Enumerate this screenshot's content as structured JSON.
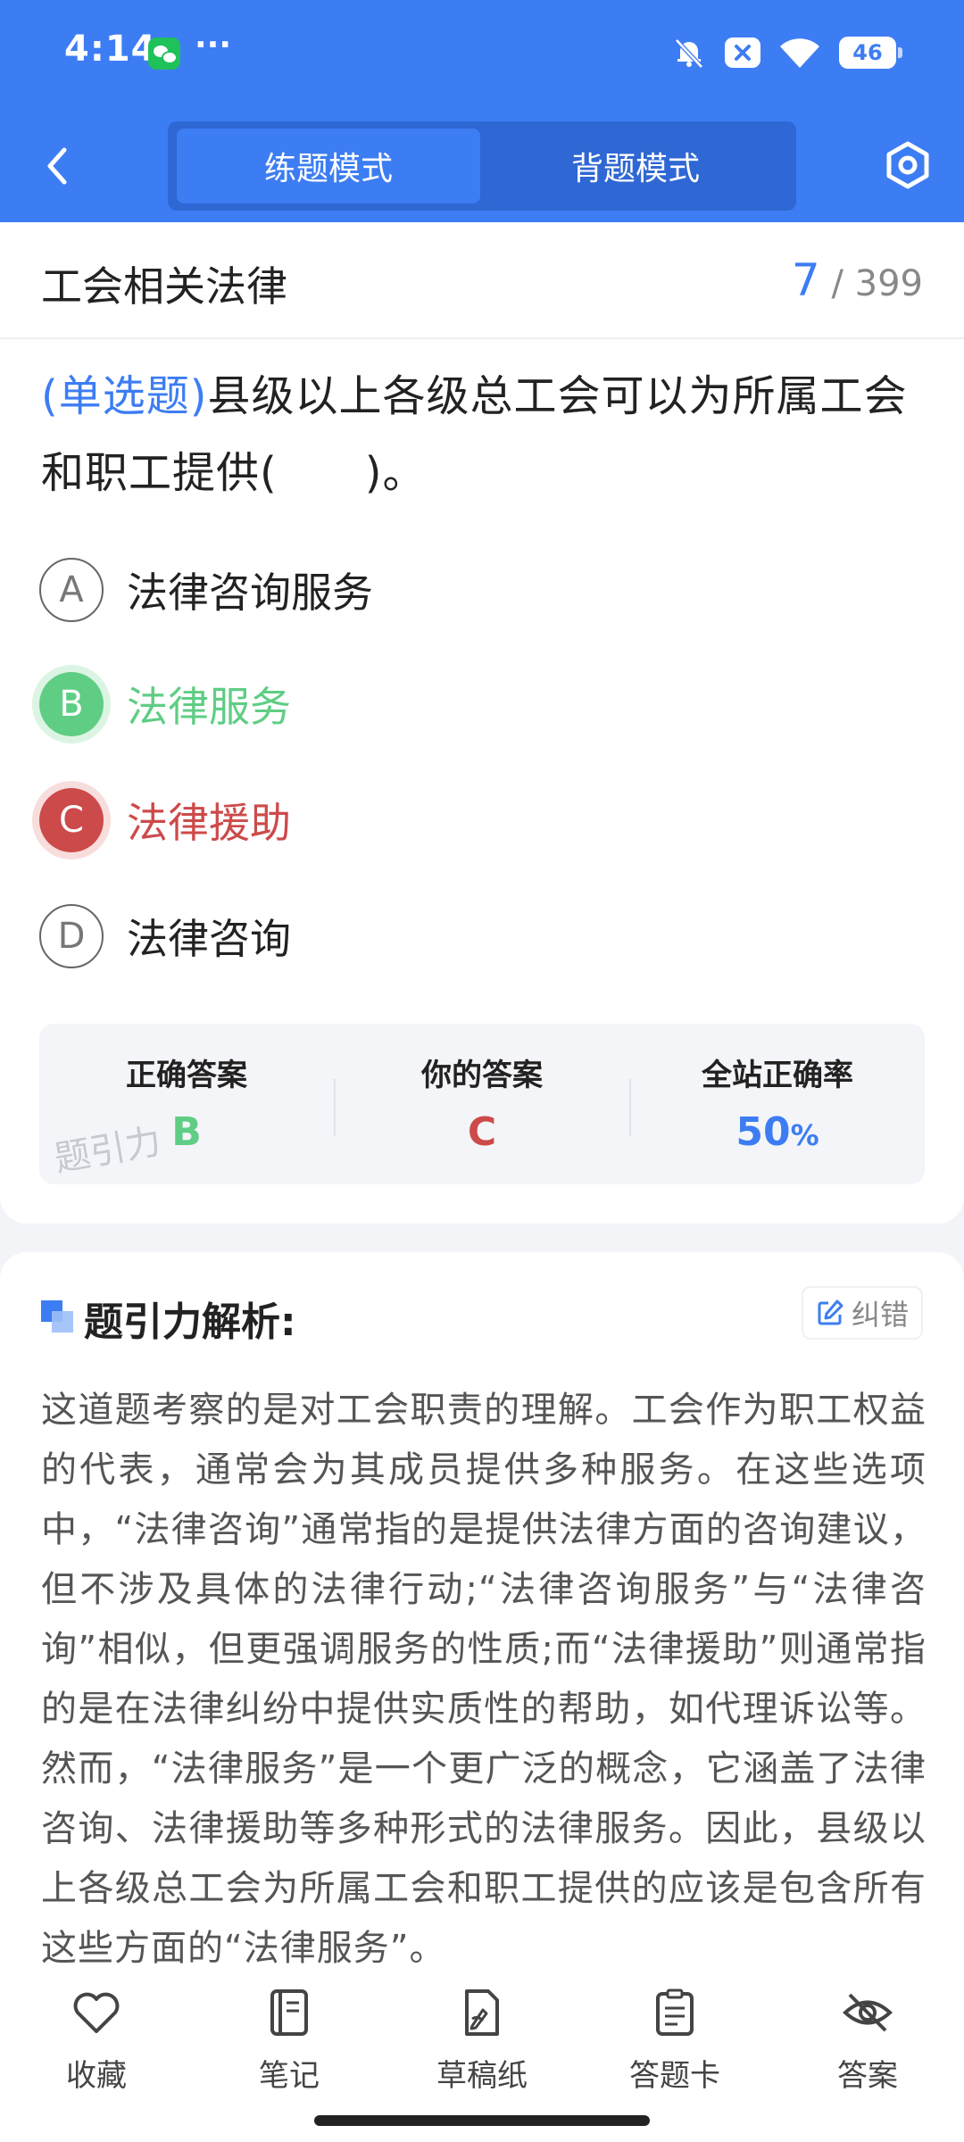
{
  "status_bar": {
    "time": "4:14",
    "more": "···",
    "battery": "46"
  },
  "header": {
    "tabs": [
      {
        "label": "练题模式"
      },
      {
        "label": "背题模式"
      }
    ]
  },
  "question": {
    "category": "工会相关法律",
    "current": "7",
    "total": "/ 399",
    "type_tag": "(单选题)",
    "stem": "县级以上各级总工会可以为所属工会和职工提供(　　)。",
    "options": [
      {
        "letter": "A",
        "text": "法律咨询服务"
      },
      {
        "letter": "B",
        "text": "法律服务"
      },
      {
        "letter": "C",
        "text": "法律援助"
      },
      {
        "letter": "D",
        "text": "法律咨询"
      }
    ]
  },
  "stats": {
    "correct_label": "正确答案",
    "correct_value": "B",
    "yours_label": "你的答案",
    "yours_value": "C",
    "rate_label": "全站正确率",
    "rate_value": "50",
    "rate_unit": "%",
    "watermark": "题引力"
  },
  "analysis": {
    "title": "题引力解析:",
    "report_label": "纠错",
    "body": "这道题考察的是对工会职责的理解。工会作为职工权益的代表，通常会为其成员提供多种服务。在这些选项中，“法律咨询”通常指的是提供法律方面的咨询建议，但不涉及具体的法律行动;“法律咨询服务”与“法律咨询”相似，但更强调服务的性质;而“法律援助”则通常指的是在法律纠纷中提供实质性的帮助，如代理诉讼等。然而，“法律服务”是一个更广泛的概念，它涵盖了法律咨询、法律援助等多种形式的法律服务。因此，县级以上各级总工会为所属工会和职工提供的应该是包含所有这些方面的“法律服务”。"
  },
  "bottom_bar": [
    {
      "label": "收藏",
      "icon": "heart-icon"
    },
    {
      "label": "笔记",
      "icon": "notebook-icon"
    },
    {
      "label": "草稿纸",
      "icon": "draft-paper-icon"
    },
    {
      "label": "答题卡",
      "icon": "answer-card-icon"
    },
    {
      "label": "答案",
      "icon": "eye-off-icon"
    }
  ],
  "colors": {
    "primary": "#3d7df3",
    "correct": "#5fcd84",
    "wrong": "#cd4a4a"
  }
}
